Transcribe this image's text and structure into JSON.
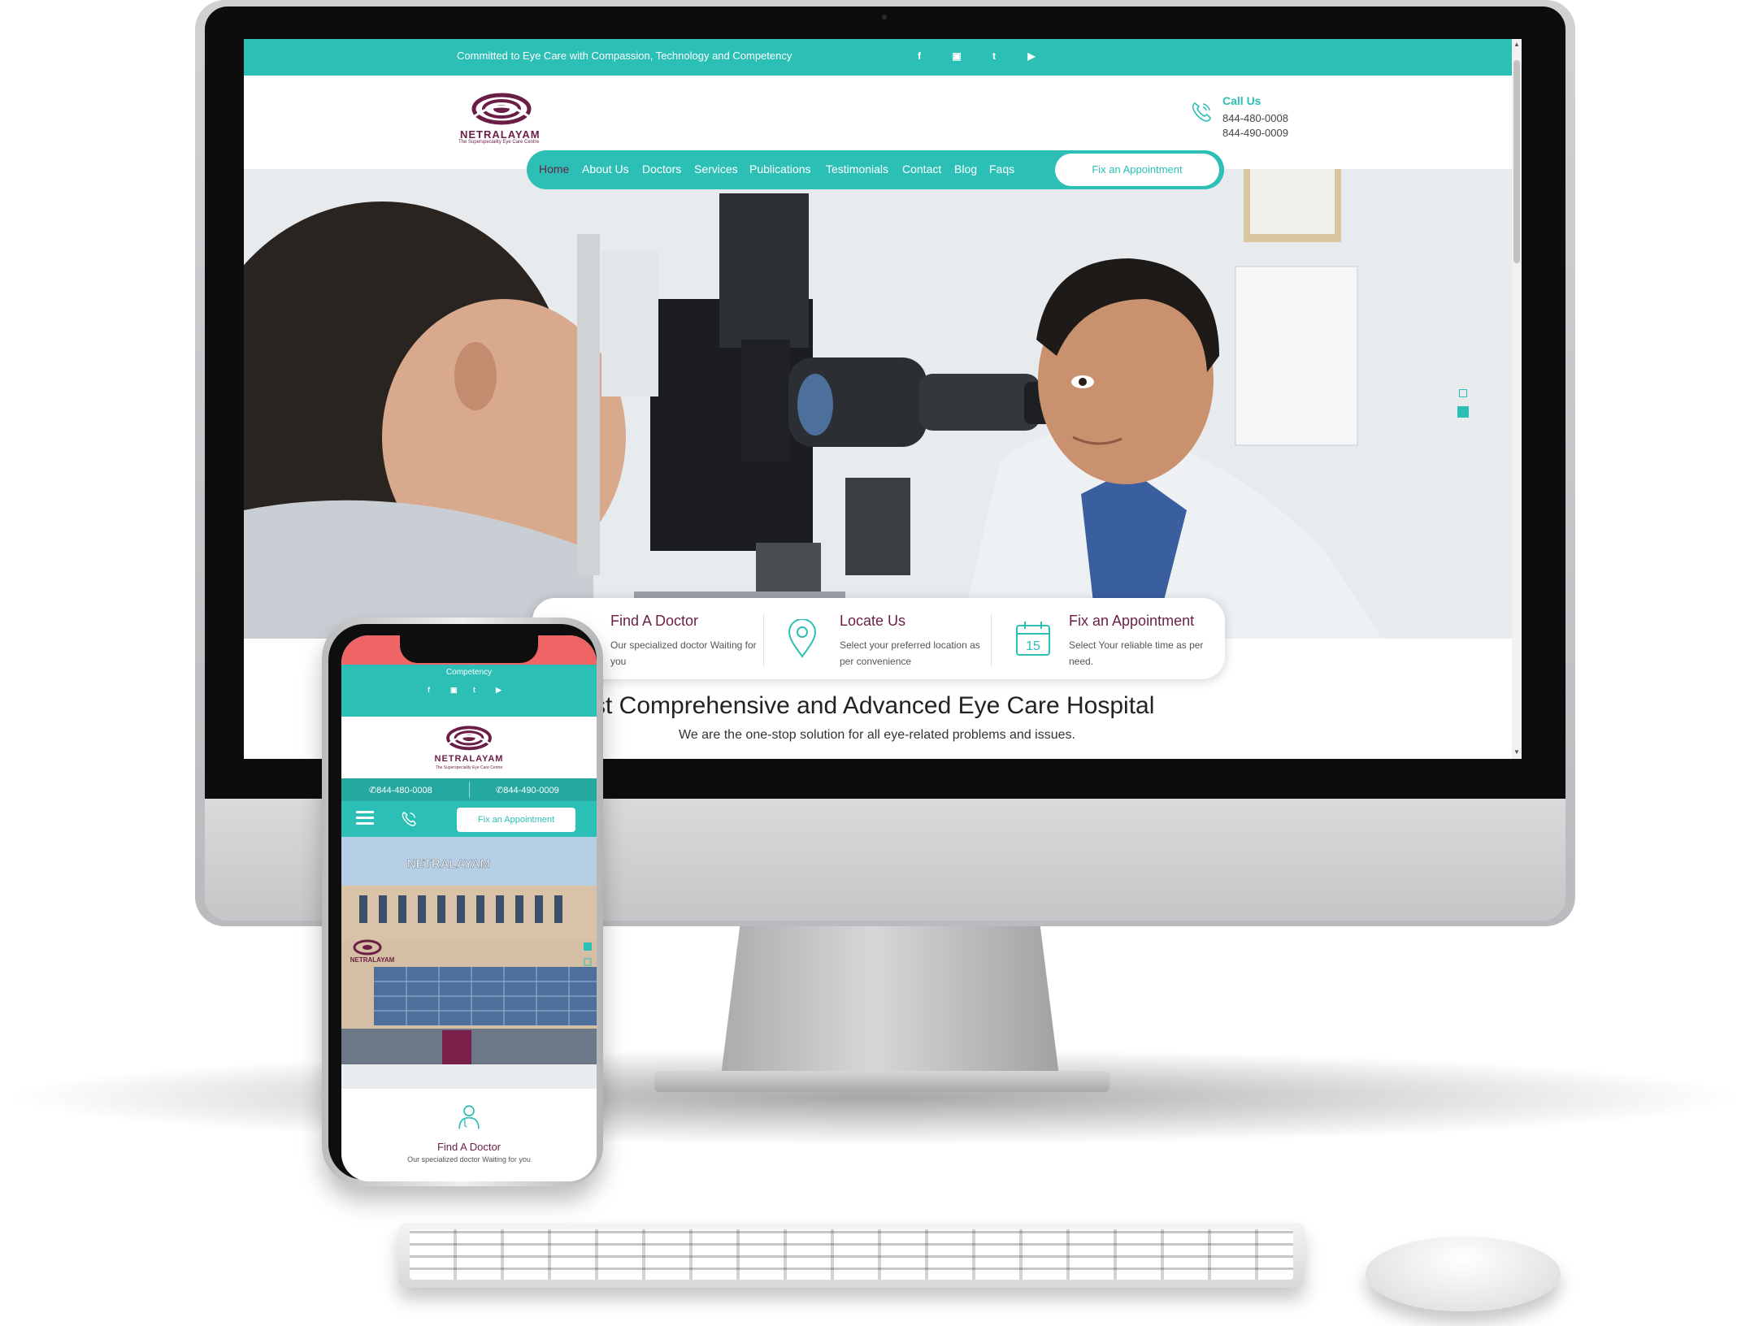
{
  "desktop": {
    "topbar": {
      "tagline": "Committed to Eye Care with Compassion, Technology and Competency",
      "social": [
        "f",
        "▣",
        "t",
        "▶"
      ]
    },
    "header": {
      "logo_name": "NETRALAYAM",
      "logo_tagline": "The Superspeciality Eye Care Centre",
      "call_label": "Call Us",
      "phone_1": "844-480-0008",
      "phone_2": "844-490-0009"
    },
    "nav": {
      "items": [
        "Home",
        "About Us",
        "Doctors",
        "Services",
        "Publications",
        "Testimonials",
        "Contact",
        "Blog",
        "Faqs"
      ],
      "active": "Home",
      "cta": "Fix an Appointment"
    },
    "features": [
      {
        "title": "Find A Doctor",
        "desc": "Our specialized doctor Waiting for you",
        "icon": "doctor-icon"
      },
      {
        "title": "Locate Us",
        "desc": "Select your preferred location as per convenience",
        "icon": "location-pin-icon"
      },
      {
        "title": "Fix an Appointment",
        "desc": "Select Your reliable time as per need.",
        "icon": "calendar-icon",
        "calendar_day": "15"
      }
    ],
    "section": {
      "title": "st Comprehensive and Advanced Eye Care Hospital",
      "subtitle": "We are the one-stop solution for all eye-related problems and issues."
    }
  },
  "mobile": {
    "tagline": "Competency",
    "social": [
      "f",
      "▣",
      "t",
      "▶"
    ],
    "logo_name": "NETRALAYAM",
    "logo_tagline": "The Superspeciality Eye Care Centre",
    "phone_1": "✆844-480-0008",
    "phone_2": "✆844-490-0009",
    "cta": "Fix an Appointment",
    "building_sign": "NETRALAYAM",
    "building_logo": "NETRALAYAM",
    "feature_title": "Find A Doctor",
    "feature_desc": "Our specialized doctor Waiting for you"
  },
  "colors": {
    "teal": "#2bbfb6",
    "plum": "#6b1e45",
    "coral": "#ef6566"
  }
}
